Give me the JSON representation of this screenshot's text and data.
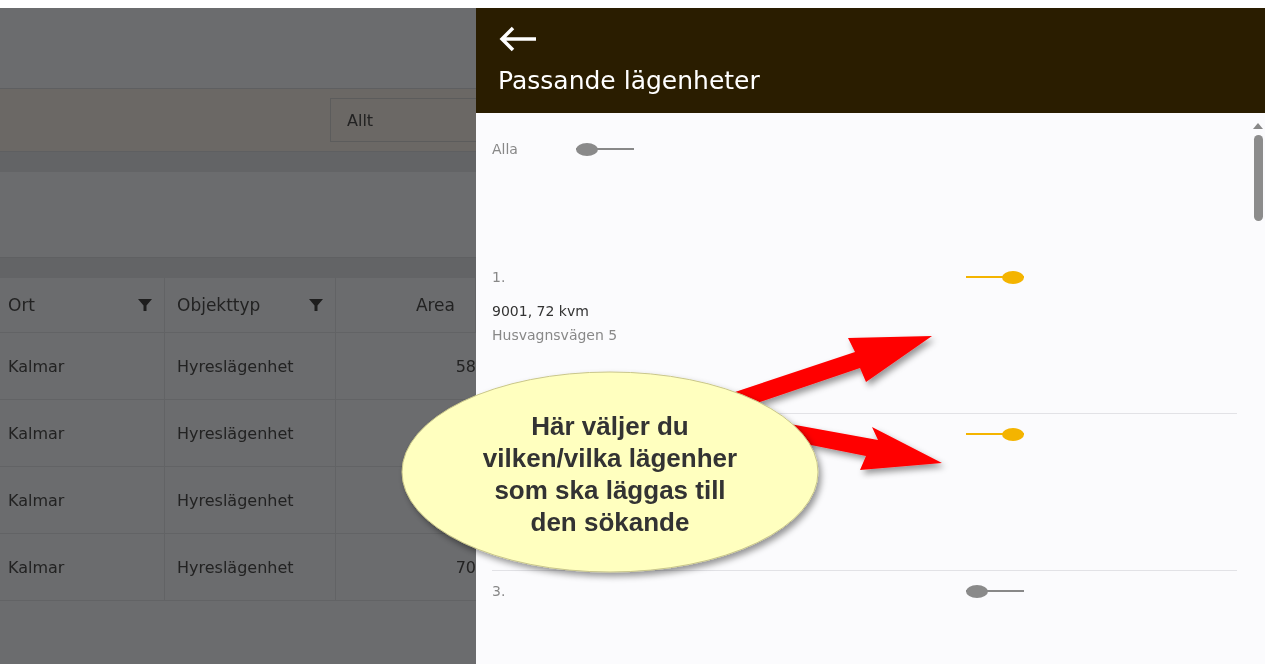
{
  "filter": {
    "value": "Allt"
  },
  "table": {
    "columns": [
      {
        "label": "Ort",
        "filter": true
      },
      {
        "label": "Objekttyp",
        "filter": true
      },
      {
        "label": "Area",
        "filter": false
      }
    ],
    "rows": [
      {
        "cells": [
          "Kalmar",
          "Hyreslägenhet",
          "58"
        ]
      },
      {
        "cells": [
          "Kalmar",
          "Hyreslägenhet",
          ""
        ]
      },
      {
        "cells": [
          "Kalmar",
          "Hyreslägenhet",
          ""
        ]
      },
      {
        "cells": [
          "Kalmar",
          "Hyreslägenhet",
          "70"
        ]
      }
    ]
  },
  "drawer": {
    "title": "Passande lägenheter",
    "all": {
      "label": "Alla",
      "on": false
    },
    "items": [
      {
        "number": "1.",
        "on": true,
        "title": "9001, 72 kvm",
        "address": "Husvagnsvägen 5"
      },
      {
        "on": true
      },
      {
        "number": "3.",
        "on": false
      }
    ]
  },
  "callout": {
    "text": "Här väljer du vilken/vilka lägenher som ska läggas till den sökande"
  }
}
